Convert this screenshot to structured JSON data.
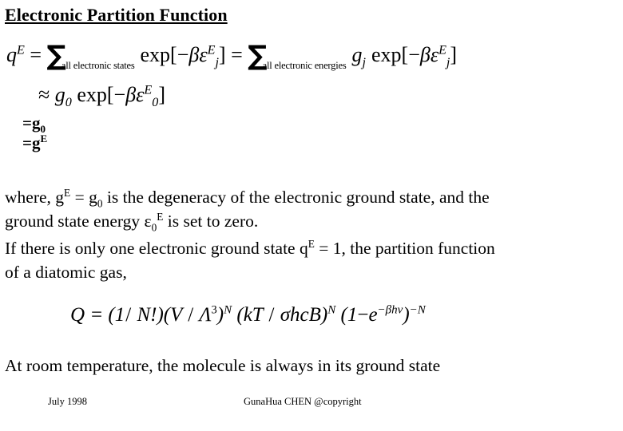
{
  "slide": {
    "title": "Electronic Partition Function",
    "equations": {
      "eq1": {
        "lhs": "q",
        "lhs_sup": "E",
        "eq_sign": "=",
        "sum1_label": "all electronic states",
        "term1_exp": "exp[",
        "term1_minus": "−",
        "term1_beta": "β",
        "term1_eps": "ε",
        "term1_sub": "j",
        "term1_sup": "E",
        "term1_close": "]",
        "eq_sign2": "=",
        "sum2_label": "all electronic energies",
        "term2_g": "g",
        "term2_g_sub": "j",
        "term2_exp": "exp[",
        "term2_minus": "−",
        "term2_beta": "β",
        "term2_eps": "ε",
        "term2_sub": "j",
        "term2_sup": "E",
        "term2_close": "]",
        "plain": "q^E = Σ(all electronic states) exp[−βε_j^E] = Σ(all electronic energies) g_j exp[−βε_j^E]"
      },
      "eq2": {
        "approx": "≈",
        "g": "g",
        "g_sub": "0",
        "exp": "exp[",
        "minus": "−",
        "beta": "β",
        "eps": "ε",
        "eps_sub": "0",
        "eps_sup": "E",
        "close": "]",
        "plain": "≈ g₀ exp[−βε₀^E]"
      },
      "g_line_1": {
        "eq": "=g",
        "sub": "0",
        "plain": "=g₀"
      },
      "g_line_2": {
        "eq": "=g",
        "sup": "E",
        "plain": "=g^E"
      },
      "eq3": {
        "Q": "Q",
        "equals": " = (1",
        "slash1": "/",
        "N_fact": " N!)(",
        "V": "V ",
        "slash2": "/",
        "Lambda": " Λ",
        "lambda_pow": "3",
        "close_paren1": ")",
        "pow_N1": "N",
        "open_paren2": " (",
        "kT": "kT ",
        "slash3": "/",
        "sigma_hcB": " σhcB",
        "close_paren2": ")",
        "pow_N2": "N",
        "open_paren3": " (1",
        "minus": "−",
        "e": "e",
        "exp_minus": "−",
        "exp_beta": "β",
        "exp_hv": "hv",
        "close_paren3": ")",
        "pow_minusN": "−N",
        "plain": "Q = (1/N!)(V / Λ³)^N (kT / σhcB)^N (1 − e^{−βhv})^{−N}"
      }
    },
    "body": {
      "line1_a": "where, g",
      "line1_sup": "E",
      "line1_b": " = g",
      "line1_sub": "0",
      "line1_c": " is the degeneracy of the electronic ground state, and the",
      "line2_a": "ground state energy ε",
      "line2_sub": "0",
      "line2_sup": "E",
      "line2_b": " is set to zero.",
      "line3_a": "If there is only one electronic ground state q",
      "line3_sup": "E",
      "line3_b": " = 1, the partition function",
      "line4": "of a diatomic gas,",
      "plain_line1": "where, g^E = g₀ is the degeneracy of the electronic ground state, and the",
      "plain_line2": "ground state energy ε₀^E is set to zero.",
      "plain_line3": "If there is only one electronic ground state q^E = 1, the partition function",
      "plain_line4": "of a diatomic gas,"
    },
    "closing": "At room temperature, the molecule is always in its ground state",
    "footer": {
      "left": "July 1998",
      "center": "GunaHua CHEN @copyright"
    },
    "colors": {
      "text": "#000000",
      "background": "#ffffff"
    }
  }
}
